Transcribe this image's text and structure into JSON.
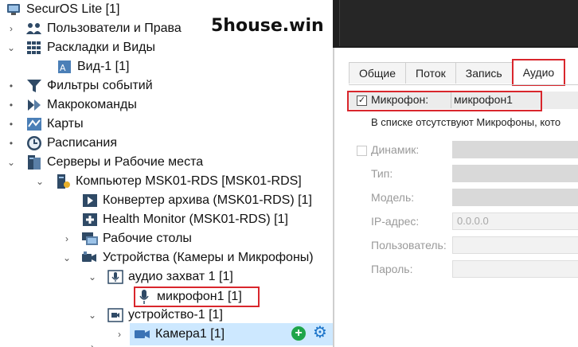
{
  "watermark": "5house.win",
  "tree": {
    "root": "SecurOS Lite [1]",
    "items": [
      {
        "label": "Пользователи и Права"
      },
      {
        "label": "Раскладки и Виды"
      },
      {
        "label": "Вид-1 [1]"
      },
      {
        "label": "Фильтры событий"
      },
      {
        "label": "Макрокоманды"
      },
      {
        "label": "Карты"
      },
      {
        "label": "Расписания"
      },
      {
        "label": "Серверы и Рабочие места"
      },
      {
        "label": "Компьютер MSK01-RDS [MSK01-RDS]"
      },
      {
        "label": "Конвертер архива (MSK01-RDS) [1]"
      },
      {
        "label": "Health Monitor (MSK01-RDS) [1]"
      },
      {
        "label": "Рабочие столы"
      },
      {
        "label": "Устройства (Камеры и Микрофоны)"
      },
      {
        "label": "аудио захват 1 [1]"
      },
      {
        "label": "микрофон1 [1]"
      },
      {
        "label": "устройство-1 [1]"
      },
      {
        "label": "Камера1 [1]"
      }
    ]
  },
  "settings": {
    "tabs": [
      "Общие",
      "Поток",
      "Запись",
      "Аудио"
    ],
    "active_tab": "Аудио",
    "microphone_label": "Микрофон:",
    "microphone_value": "микрофон1",
    "info_text": "В списке отсутствуют Микрофоны, кото",
    "speaker_label": "Динамик:",
    "type_label": "Тип:",
    "model_label": "Модель:",
    "ip_label": "IP-адрес:",
    "ip_value": "0.0.0.0",
    "user_label": "Пользователь:",
    "password_label": "Пароль:"
  },
  "colors": {
    "highlight": "#d9262c",
    "selection": "#cde8ff"
  }
}
